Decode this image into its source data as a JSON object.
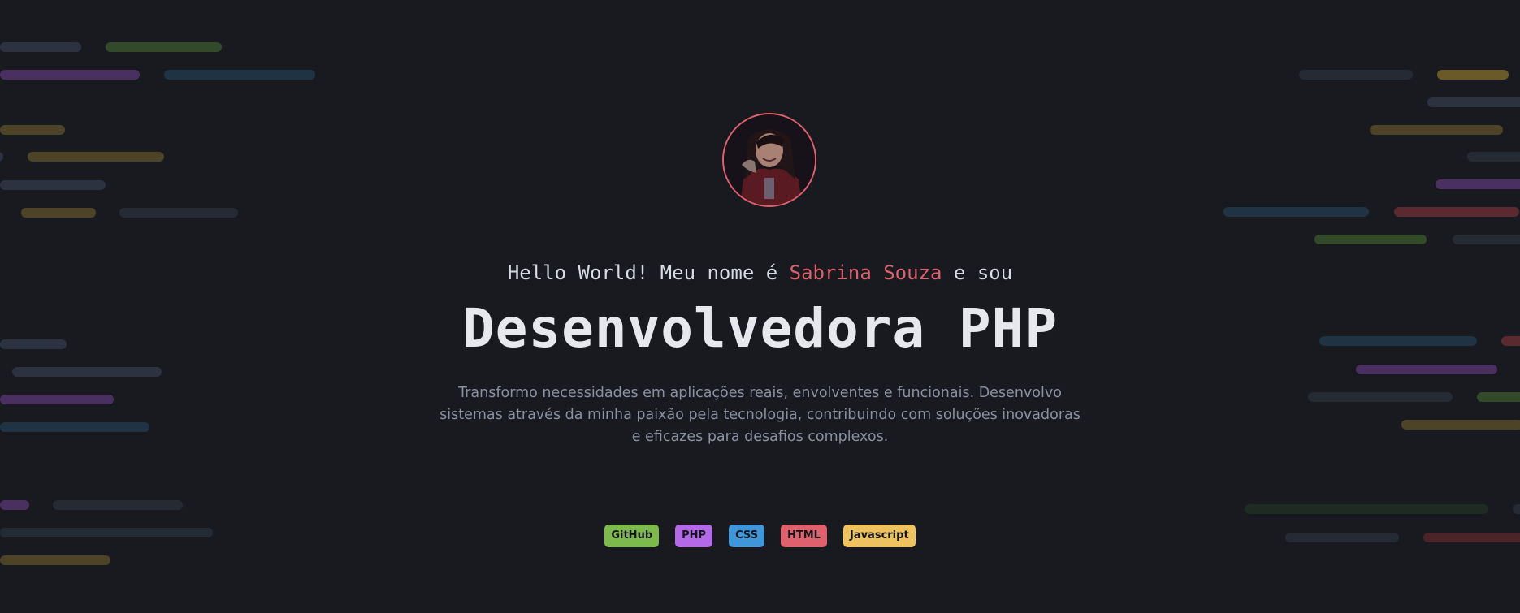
{
  "hero": {
    "greeting_prefix": "Hello World! Meu nome é",
    "name": "Sabrina Souza",
    "greeting_suffix": "e sou",
    "title": "Desenvolvedora PHP",
    "description": "Transformo necessidades em aplicações reais, envolventes e funcionais. Desenvolvo sistemas através da minha paixão pela tecnologia, contribuindo com soluções inovadoras e eficazes para desafios complexos."
  },
  "avatar": {
    "icon": "profile-photo",
    "border_color": "#e0616e"
  },
  "tags": [
    {
      "label": "GitHub",
      "color": "#7cba4e"
    },
    {
      "label": "PHP",
      "color": "#b46ae8"
    },
    {
      "label": "CSS",
      "color": "#3f96d8"
    },
    {
      "label": "HTML",
      "color": "#e0616e"
    },
    {
      "label": "Javascript",
      "color": "#eec25e"
    }
  ],
  "colors": {
    "background": "#181a20",
    "accent": "#e0616e",
    "text": "#e6e8ee",
    "muted": "#8a90a0"
  }
}
